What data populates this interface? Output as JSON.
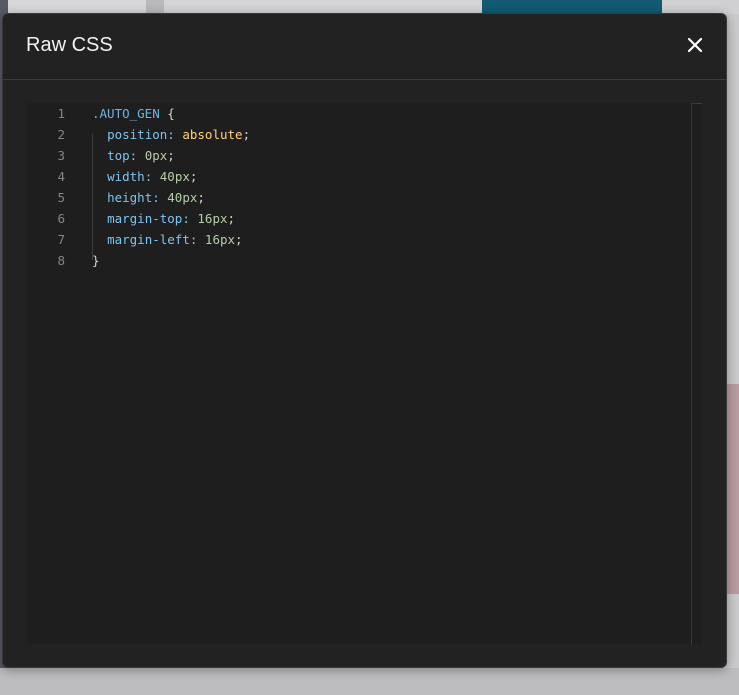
{
  "modal": {
    "title": "Raw CSS",
    "close_icon": "close-icon"
  },
  "editor": {
    "line_numbers": [
      "1",
      "2",
      "3",
      "4",
      "5",
      "6",
      "7",
      "8"
    ],
    "lines": [
      {
        "selector": ".AUTO_GEN",
        "open": " {"
      },
      {
        "prop": "position",
        "value": "absolute",
        "value_type": "keyword"
      },
      {
        "prop": "top",
        "value": "0px",
        "value_type": "number"
      },
      {
        "prop": "width",
        "value": "40px",
        "value_type": "number"
      },
      {
        "prop": "height",
        "value": "40px",
        "value_type": "number"
      },
      {
        "prop": "margin-top",
        "value": "16px",
        "value_type": "number"
      },
      {
        "prop": "margin-left",
        "value": "16px",
        "value_type": "number"
      },
      {
        "close": "}"
      }
    ]
  },
  "colors": {
    "modal_bg": "#222222",
    "editor_bg": "#1e1e1e",
    "selector": "#6fb3e0",
    "property": "#7cc4f0",
    "keyword_value": "#ffd37a",
    "number_value": "#b5cea8"
  }
}
